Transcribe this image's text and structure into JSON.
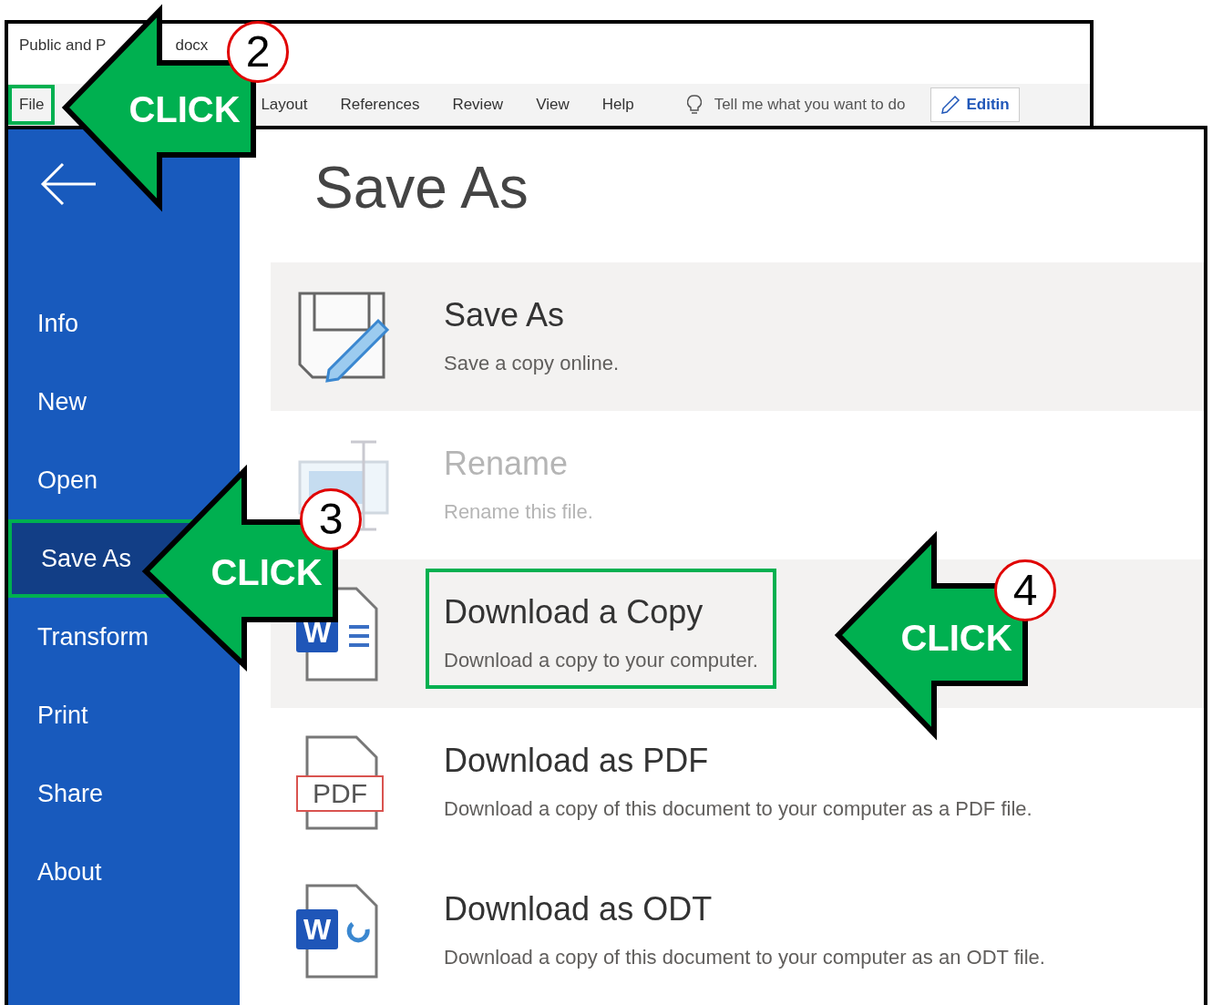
{
  "back_window": {
    "title_parts": [
      "Public and P",
      "docx"
    ],
    "tabs": [
      {
        "label": "File",
        "highlighted": true
      },
      {
        "label": "Layout",
        "highlighted": false
      },
      {
        "label": "References",
        "highlighted": false
      },
      {
        "label": "Review",
        "highlighted": false
      },
      {
        "label": "View",
        "highlighted": false
      },
      {
        "label": "Help",
        "highlighted": false
      }
    ],
    "search": {
      "placeholder": "Tell me what you want to do"
    },
    "mode_button": "Editin"
  },
  "sidebar": {
    "items": [
      {
        "label": "Info",
        "selected": false,
        "highlighted": false
      },
      {
        "label": "New",
        "selected": false,
        "highlighted": false
      },
      {
        "label": "Open",
        "selected": false,
        "highlighted": false
      },
      {
        "label": "Save As",
        "selected": true,
        "highlighted": true
      },
      {
        "label": "Transform",
        "selected": false,
        "highlighted": false
      },
      {
        "label": "Print",
        "selected": false,
        "highlighted": false
      },
      {
        "label": "Share",
        "selected": false,
        "highlighted": false
      },
      {
        "label": "About",
        "selected": false,
        "highlighted": false
      }
    ]
  },
  "heading": "Save As",
  "options": [
    {
      "kind": "save",
      "title": "Save As",
      "description": "Save a copy online.",
      "shaded": true,
      "disabled": false,
      "highlighted": false
    },
    {
      "kind": "rename",
      "title": "Rename",
      "description": "Rename this file.",
      "shaded": false,
      "disabled": true,
      "highlighted": false
    },
    {
      "kind": "word",
      "icon_text": "W",
      "title": "Download a Copy",
      "description": "Download a copy to your computer.",
      "shaded": true,
      "disabled": false,
      "highlighted": true
    },
    {
      "kind": "pdf",
      "icon_text": "PDF",
      "title": "Download as PDF",
      "description": "Download a copy of this document to your computer as a PDF file.",
      "shaded": false,
      "disabled": false,
      "highlighted": false
    },
    {
      "kind": "odt",
      "icon_text": "W",
      "title": "Download as ODT",
      "description": "Download a copy of this document to your computer as an ODT file.",
      "shaded": false,
      "disabled": false,
      "highlighted": false
    }
  ],
  "annotations": [
    {
      "step": "2",
      "label": "CLICK"
    },
    {
      "step": "3",
      "label": "CLICK"
    },
    {
      "step": "4",
      "label": "CLICK"
    }
  ]
}
